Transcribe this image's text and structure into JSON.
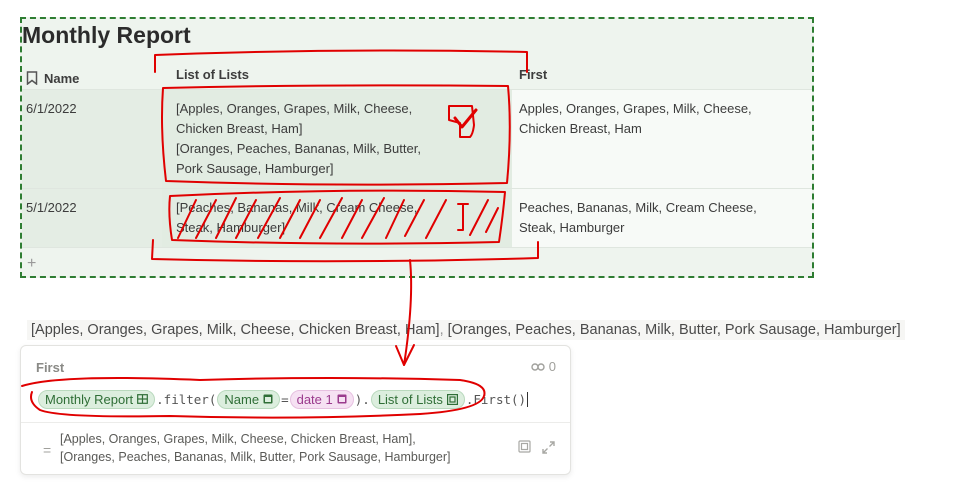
{
  "table": {
    "title": "Monthly Report",
    "columns": {
      "name": "Name",
      "list_of_lists": "List of Lists",
      "first": "First"
    },
    "rows": [
      {
        "name": "6/1/2022",
        "list_of_lists": [
          "[Apples, Oranges, Grapes, Milk, Cheese,",
          "Chicken Breast, Ham]",
          "[Oranges, Peaches, Bananas, Milk, Butter,",
          "Pork Sausage, Hamburger]"
        ],
        "first": [
          "Apples, Oranges, Grapes, Milk, Cheese,",
          "Chicken Breast, Ham"
        ]
      },
      {
        "name": "5/1/2022",
        "list_of_lists": [
          "[Peaches, Bananas, Milk, Cream Cheese,",
          "Steak, Hamburger]"
        ],
        "first": [
          "Peaches, Bananas, Milk, Cream Cheese,",
          "Steak, Hamburger"
        ]
      }
    ],
    "add_row": "+"
  },
  "result_line": {
    "part1": "[Apples, Oranges, Grapes, Milk, Cheese, Chicken Breast, Ham]",
    "part2": "[Oranges, Peaches, Bananas, Milk, Butter, Pork Sausage, Hamburger]"
  },
  "editor": {
    "title": "First",
    "ref_count": "0",
    "formula": {
      "db_chip": "Monthly Report",
      "filter_call": ".filter(",
      "name_chip": "Name",
      "equals": "=",
      "date_chip": "date 1",
      "close_paren": ").",
      "lol_chip": "List of Lists",
      "first_call": ".First()"
    },
    "equals_sign": "=",
    "output": [
      "[Apples, Oranges, Grapes, Milk, Cheese, Chicken Breast, Ham],",
      "[Oranges, Peaches, Bananas, Milk, Butter, Pork Sausage, Hamburger]"
    ]
  },
  "colors": {
    "accent_green": "#2e7d32",
    "annotation_red": "#e00000"
  }
}
